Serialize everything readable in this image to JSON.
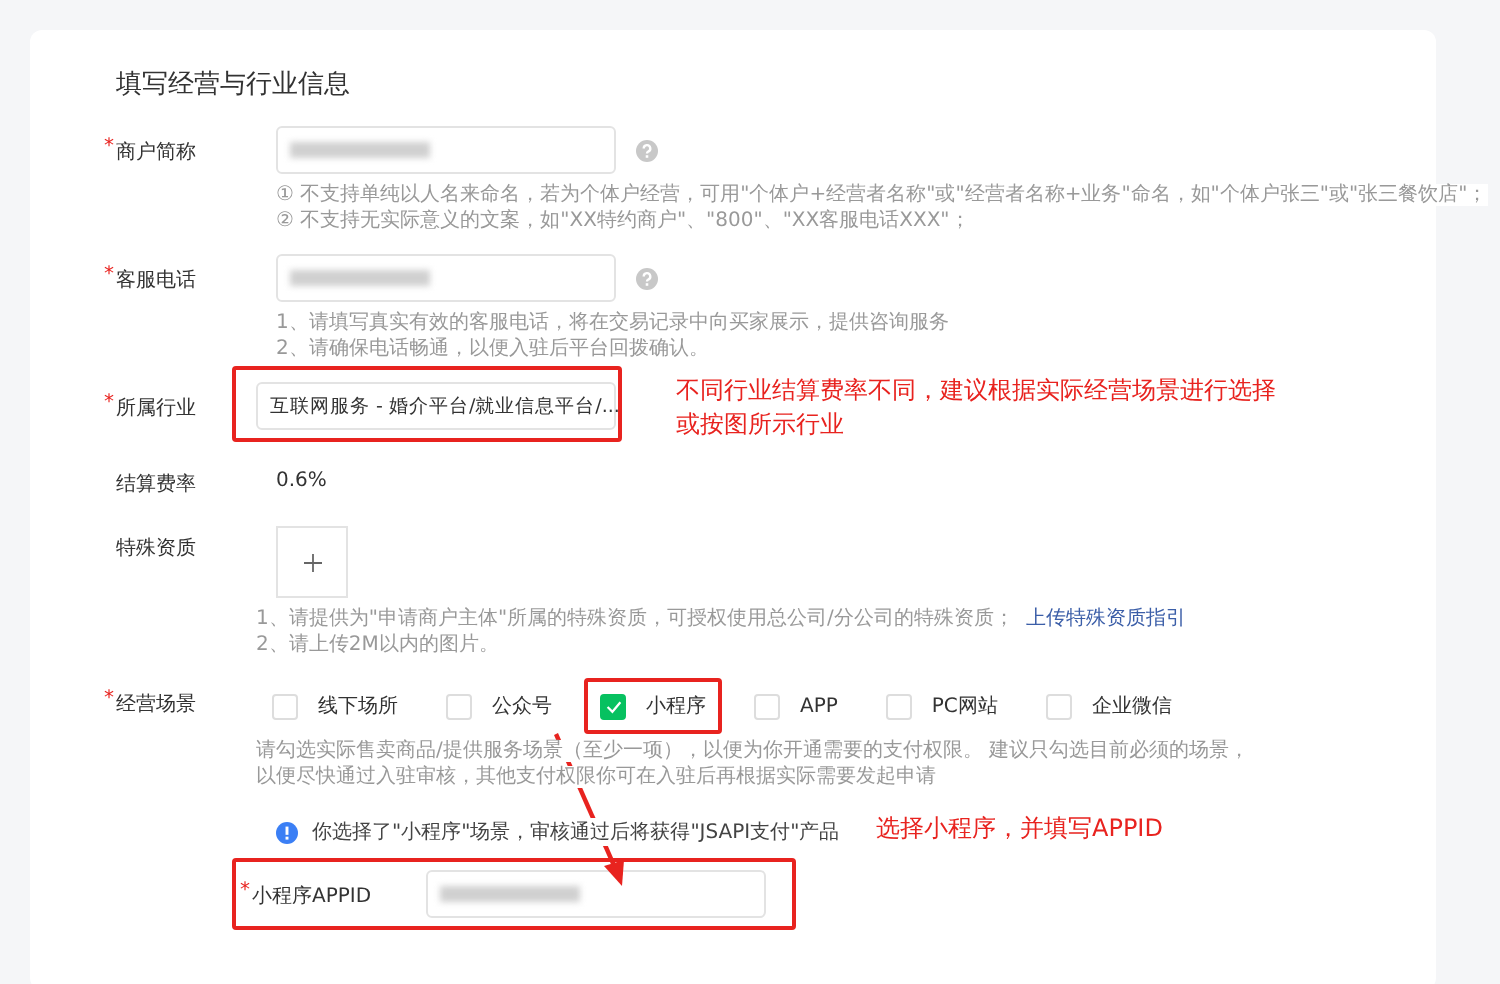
{
  "section_title": "填写经营与行业信息",
  "fields": [
    {
      "kind": "input",
      "marker": "*",
      "label": "商户简称",
      "blurred": true,
      "help": true,
      "hints": [
        "① 不支持单纯以人名来命名，若为个体户经营，可用\"个体户+经营者名称\"或\"经营者名称+业务\"命名，如\"个体户张三\"或\"张三餐饮店\"；",
        "② 不支持无实际意义的文案，如\"XX特约商户\"、\"800\"、\"XX客服电话XXX\"；"
      ]
    },
    {
      "kind": "input",
      "marker": "*",
      "label": "客服电话",
      "blurred": true,
      "help": true,
      "hints": [
        "1、请填写真实有效的客服电话，将在交易记录中向买家展示，提供咨询服务",
        "2、请确保电话畅通，以便入驻后平台回拨确认。"
      ]
    },
    {
      "kind": "select",
      "marker": "*",
      "label": "所属行业",
      "value": "互联网服务 - 婚介平台/就业信息平台/...",
      "highlighted": true,
      "annotation": [
        "不同行业结算费率不同，建议根据实际经营场景进行选择",
        "或按图所示行业"
      ]
    },
    {
      "kind": "text",
      "label": "结算费率",
      "value": "0.6%"
    },
    {
      "kind": "upload",
      "label": "特殊资质",
      "hints": [
        "1、请提供为\"申请商户主体\"所属的特殊资质，可授权使用总公司/分公司的特殊资质；",
        "2、请上传2M以内的图片。"
      ],
      "link": "上传特殊资质指引"
    },
    {
      "kind": "checkboxes",
      "marker": "*",
      "label": "经营场景",
      "options": [
        {
          "label": "线下场所",
          "checked": false
        },
        {
          "label": "公众号",
          "checked": false
        },
        {
          "label": "小程序",
          "checked": true,
          "highlighted": true
        },
        {
          "label": "APP",
          "checked": false
        },
        {
          "label": "PC网站",
          "checked": false
        },
        {
          "label": "企业微信",
          "checked": false
        }
      ],
      "hints": [
        "请勾选实际售卖商品/提供服务场景（至少一项），以便为你开通需要的支付权限。 建议只勾选目前必须的场景，",
        "以便尽快通过入驻审核，其他支付权限你可在入驻后再根据实际需要发起申请"
      ]
    },
    {
      "kind": "notice",
      "text": "你选择了\"小程序\"场景，审核通过后将获得\"JSAPI支付\"产品",
      "annotation": [
        "选择小程序，并填写APPID"
      ]
    },
    {
      "kind": "input",
      "marker": "*",
      "label": "小程序APPID",
      "blurred": true,
      "highlighted": true
    }
  ]
}
